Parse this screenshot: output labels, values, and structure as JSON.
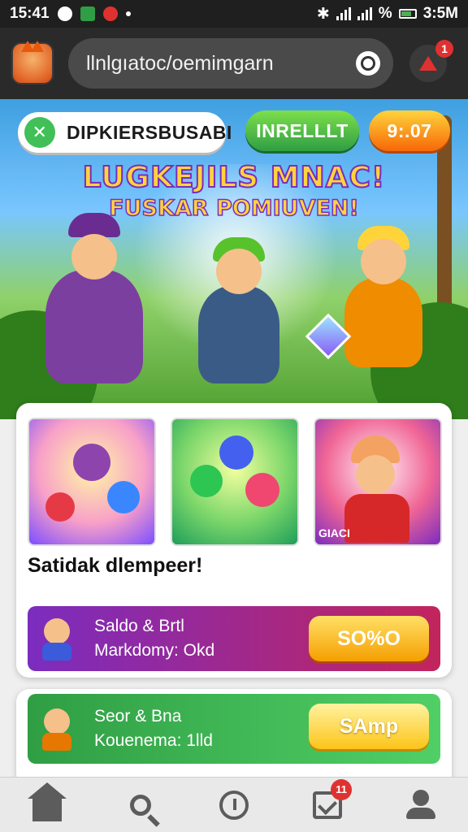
{
  "status_bar": {
    "time": "15:41",
    "right_text": "3:5M",
    "battery_label": "%"
  },
  "browser": {
    "url": "llnlgıatoc/oemimgarn",
    "notification_count": "1"
  },
  "hero": {
    "player_name": "DIPKIERSBUSABI",
    "level_button": "INRELLLT",
    "coins": "9:.07",
    "headline_line1": "LUGKEJILS MNAC!",
    "headline_line2": "FUSKAR POMIUVEN!"
  },
  "thumbnails": [
    {
      "caption": ""
    },
    {
      "caption": ""
    },
    {
      "caption": "GIACI"
    }
  ],
  "panel_title": "Satidak dlempeer!",
  "offers": [
    {
      "title": "Saldo & Brtl",
      "subtitle": "Markdomy: Okd",
      "button": "SO%O",
      "accent": "#7b2cbf"
    },
    {
      "title": "Seor & Bna",
      "subtitle": "Kouenema: 1lld",
      "button": "SAmp",
      "accent": "#2f9e44"
    }
  ],
  "bottom_nav": {
    "items": [
      "home-icon",
      "search-icon",
      "clock-icon",
      "tasks-icon",
      "profile-icon"
    ],
    "tasks_badge": "11"
  }
}
